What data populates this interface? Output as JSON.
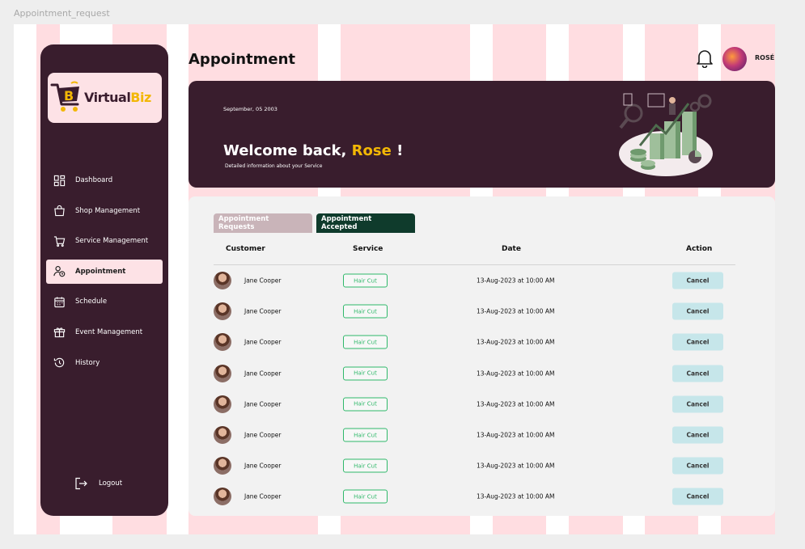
{
  "frame": {
    "label": "Appointment_request"
  },
  "brand": {
    "name_part1": "Virtual",
    "name_part2": "Biz"
  },
  "sidebar": {
    "items": [
      {
        "label": "Dashboard",
        "icon": "dashboard-icon"
      },
      {
        "label": "Shop Management",
        "icon": "shopping-bag-icon"
      },
      {
        "label": "Service Management",
        "icon": "cart-icon"
      },
      {
        "label": "Appointment",
        "icon": "user-clock-icon",
        "active": true
      },
      {
        "label": "Schedule",
        "icon": "calendar-icon"
      },
      {
        "label": "Event Management",
        "icon": "gift-icon"
      },
      {
        "label": "History",
        "icon": "history-icon"
      }
    ],
    "logout_label": "Logout"
  },
  "header": {
    "title": "Appointment",
    "user_name": "ROSÉ"
  },
  "banner": {
    "date": "September, 05 2003",
    "welcome_prefix": "Welcome back, ",
    "welcome_name": "Rose",
    "welcome_suffix": " !",
    "subtitle": "Detailed information about your Service"
  },
  "tabs": [
    {
      "label": "Appointment Requests",
      "active": false
    },
    {
      "label": "Appointment Accepted",
      "active": true
    }
  ],
  "table": {
    "columns": [
      "Customer",
      "Service",
      "Date",
      "Action"
    ],
    "rows": [
      {
        "customer": "Jane Cooper",
        "service": "Hair Cut",
        "date": "13-Aug-2023 at 10:00 AM",
        "action": "Cancel"
      },
      {
        "customer": "Jane Cooper",
        "service": "Hair Cut",
        "date": "13-Aug-2023 at 10:00 AM",
        "action": "Cancel"
      },
      {
        "customer": "Jane Cooper",
        "service": "Hair Cut",
        "date": "13-Aug-2023 at 10:00 AM",
        "action": "Cancel"
      },
      {
        "customer": "Jane Cooper",
        "service": "Hair Cut",
        "date": "13-Aug-2023 at 10:00 AM",
        "action": "Cancel"
      },
      {
        "customer": "Jane Cooper",
        "service": "Hair Cut",
        "date": "13-Aug-2023 at 10:00 AM",
        "action": "Cancel"
      },
      {
        "customer": "Jane Cooper",
        "service": "Hair Cut",
        "date": "13-Aug-2023 at 10:00 AM",
        "action": "Cancel"
      },
      {
        "customer": "Jane Cooper",
        "service": "Hair Cut",
        "date": "13-Aug-2023 at 10:00 AM",
        "action": "Cancel"
      },
      {
        "customer": "Jane Cooper",
        "service": "Hair Cut",
        "date": "13-Aug-2023 at 10:00 AM",
        "action": "Cancel"
      }
    ]
  },
  "colors": {
    "brand_dark": "#391d2d",
    "accent_yellow": "#f2b705",
    "active_nav_bg": "#fde2e6",
    "accepted_tab": "#0f3b2c",
    "service_green": "#2fb86a",
    "cancel_bg": "#c6e6ea"
  }
}
